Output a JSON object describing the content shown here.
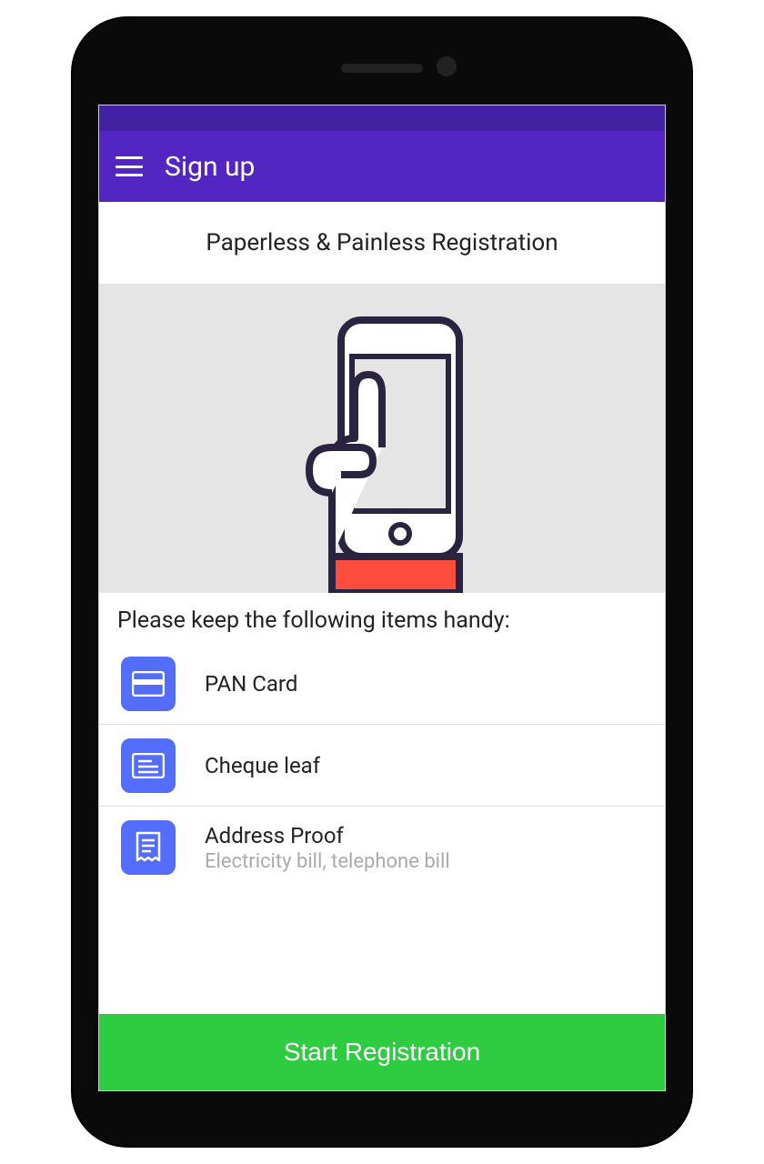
{
  "appbar": {
    "title": "Sign up"
  },
  "hero": {
    "title": "Paperless & Painless Registration"
  },
  "instruction": "Please keep the following items handy:",
  "items": [
    {
      "title": "PAN Card",
      "sub": ""
    },
    {
      "title": "Cheque leaf",
      "sub": ""
    },
    {
      "title": "Address Proof",
      "sub": "Electricity bill, telephone bill"
    }
  ],
  "cta": {
    "label": "Start Registration"
  },
  "colors": {
    "appbar": "#5326c4",
    "statusbar": "#4222a3",
    "iconbox": "#536dfe",
    "cta": "#2ecc40"
  }
}
